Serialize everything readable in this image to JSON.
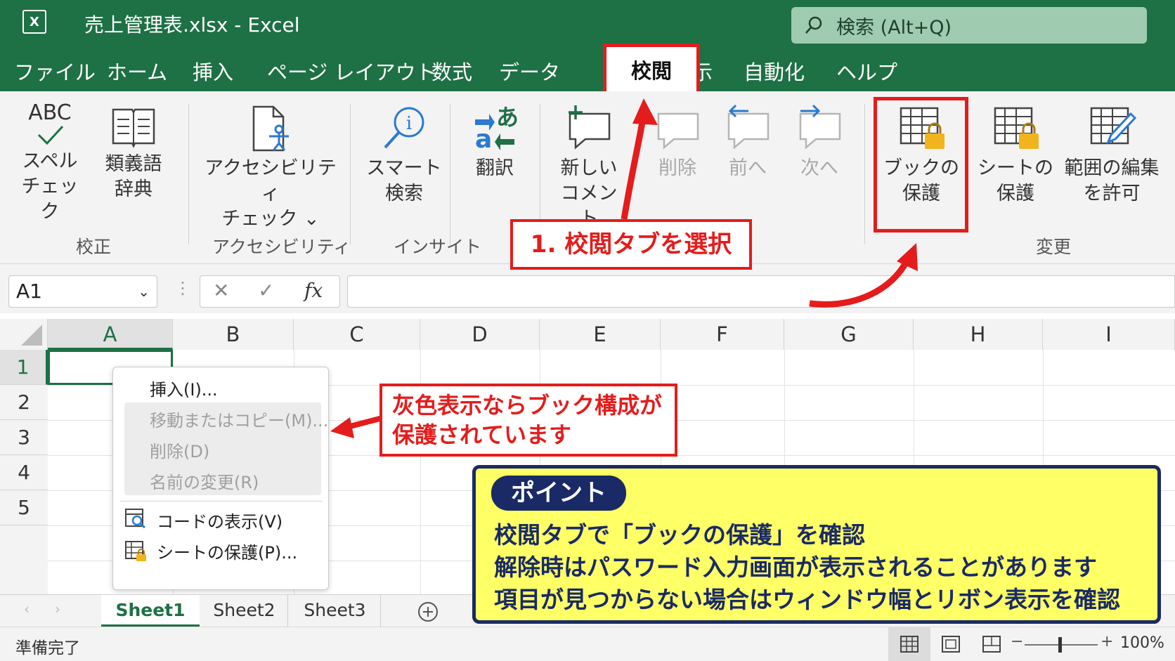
{
  "window": {
    "title": "売上管理表.xlsx  -  Excel",
    "search_placeholder": "検索 (Alt+Q)",
    "logo_text": "X"
  },
  "menu": {
    "tabs": [
      "ファイル",
      "ホーム",
      "挿入",
      "ページ レイアウト",
      "数式",
      "データ",
      "校閲",
      "表示",
      "自動化",
      "ヘルプ"
    ],
    "active_tab": "校閲"
  },
  "ribbon": {
    "groups": {
      "proofing": "校正",
      "accessibility": "アクセシビリティ",
      "insights": "インサイト",
      "changes": "変更"
    },
    "buttons": {
      "spell_line1": "スペル",
      "spell_line2": "チェック",
      "thesaurus_line1": "類義語",
      "thesaurus_line2": "辞典",
      "a11y_line1": "アクセシビリティ",
      "a11y_line2": "チェック ⌄",
      "smart_line1": "スマート",
      "smart_line2": "検索",
      "translate": "翻訳",
      "new_comment_line1": "新しい",
      "new_comment_line2": "コメント",
      "delete": "削除",
      "prev": "前へ",
      "next": "次へ",
      "protect_book_line1": "ブックの",
      "protect_book_line2": "保護",
      "protect_sheet_line1": "シートの",
      "protect_sheet_line2": "保護",
      "allow_edit_line1": "範囲の編集",
      "allow_edit_line2": "を許可",
      "abc_text": "ABC"
    }
  },
  "formula_bar": {
    "name_box": "A1",
    "fx": "fx"
  },
  "grid": {
    "columns": [
      "A",
      "B",
      "C",
      "D",
      "E",
      "F",
      "G",
      "H",
      "I"
    ],
    "rows": [
      "1",
      "2",
      "3",
      "4",
      "5"
    ]
  },
  "context_menu": {
    "items": [
      {
        "label": "挿入(I)...",
        "enabled": true
      },
      {
        "label": "移動またはコピー(M)...",
        "enabled": false
      },
      {
        "label": "削除(D)",
        "enabled": false
      },
      {
        "label": "名前の変更(R)",
        "enabled": false
      },
      {
        "label": "コードの表示(V)",
        "enabled": true
      },
      {
        "label": "シートの保護(P)...",
        "enabled": true
      }
    ]
  },
  "sheets": {
    "tabs": [
      "Sheet1",
      "Sheet2",
      "Sheet3"
    ],
    "active": "Sheet1"
  },
  "status": {
    "ready": "準備完了",
    "zoom": "100%"
  },
  "annotations": {
    "step1": "1. 校閲タブを選択",
    "gray_line1": "灰色表示ならブック構成が",
    "gray_line2": "保護されています",
    "point_label": "ポイント",
    "point_lines": [
      "校閲タブで「ブックの保護」を確認",
      "解除時はパスワード入力画面が表示されることがあります",
      "項目が見つからない場合はウィンドウ幅とリボン表示を確認"
    ]
  },
  "colors": {
    "excel_green": "#1e7045",
    "highlight_red": "#e41c1c",
    "point_yellow": "#ffff66",
    "point_navy": "#1a2a66"
  }
}
